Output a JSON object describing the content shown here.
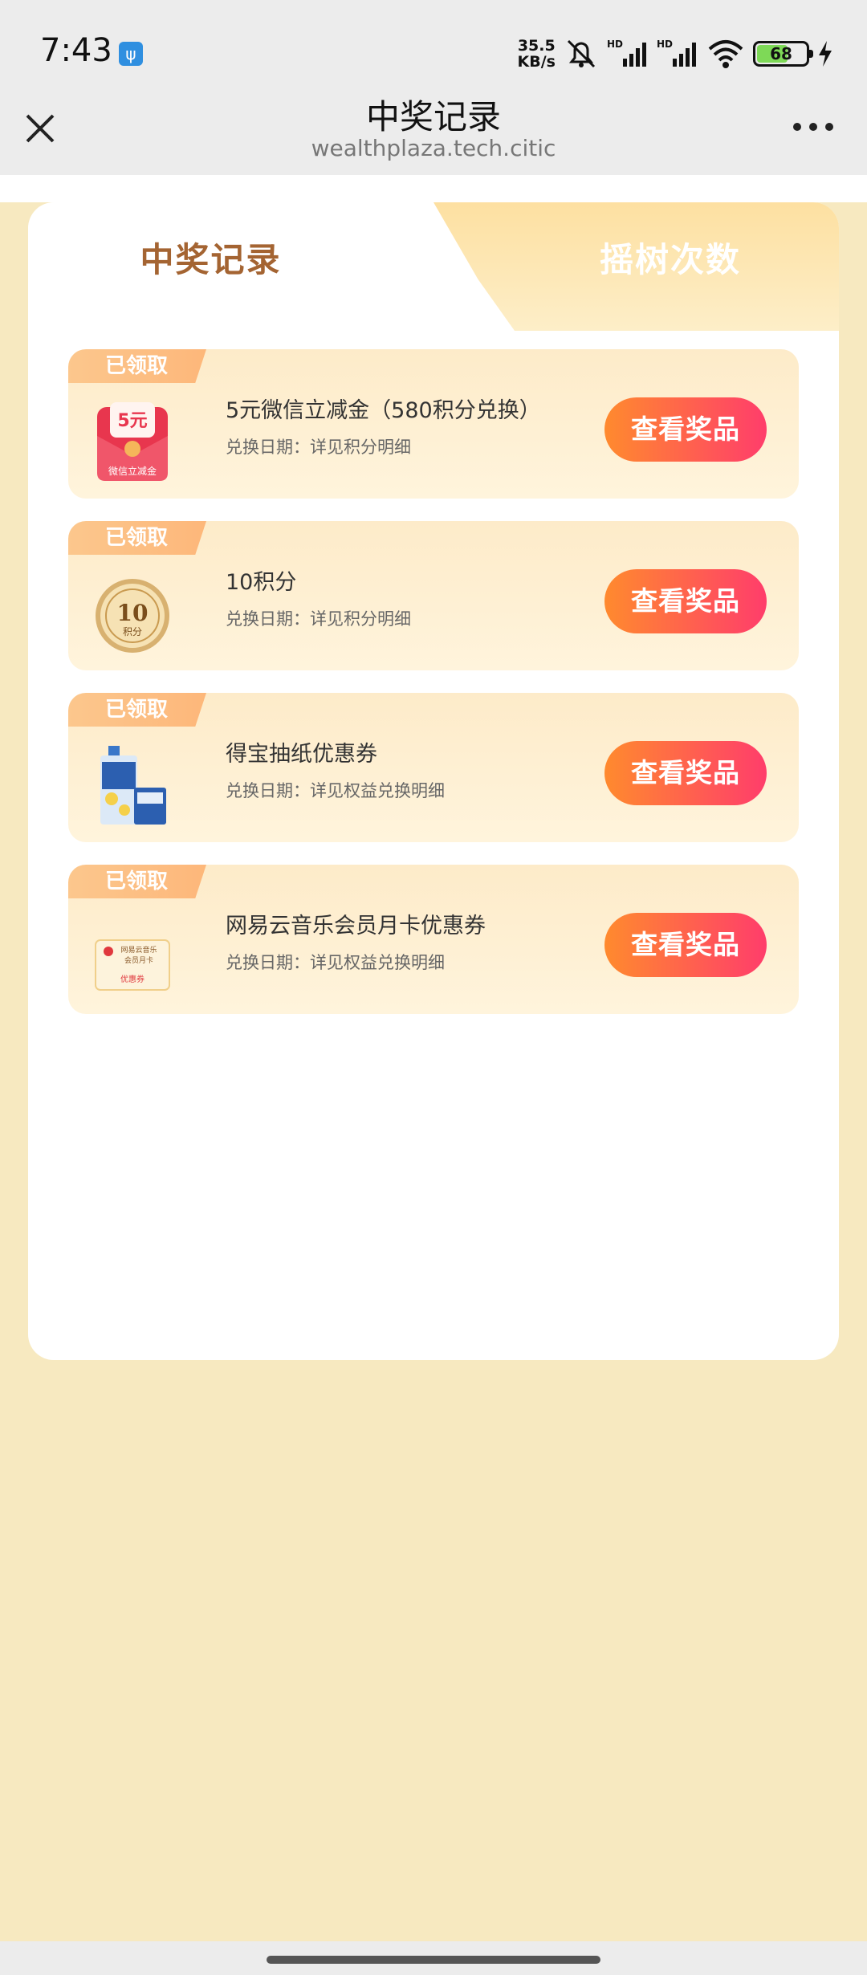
{
  "status": {
    "time": "7:43",
    "speed_top": "35.5",
    "speed_bottom": "KB/s",
    "battery": "68"
  },
  "nav": {
    "title": "中奖记录",
    "url": "wealthplaza.tech.citic"
  },
  "tabs": [
    {
      "label": "中奖记录",
      "active": true
    },
    {
      "label": "摇树次数",
      "active": false
    }
  ],
  "records": [
    {
      "badge": "已领取",
      "title": "5元微信立减金（580积分兑换）",
      "date": "兑换日期：详见积分明细",
      "button": "查看奖品",
      "thumb_text_top": "5元",
      "thumb_text_bottom": "微信立减金"
    },
    {
      "badge": "已领取",
      "title": "10积分",
      "date": "兑换日期：详见积分明细",
      "button": "查看奖品",
      "thumb_text_top": "10",
      "thumb_text_bottom": "积分"
    },
    {
      "badge": "已领取",
      "title": "得宝抽纸优惠券",
      "date": "兑换日期：详见权益兑换明细",
      "button": "查看奖品"
    },
    {
      "badge": "已领取",
      "title": "网易云音乐会员月卡优惠券",
      "date": "兑换日期：详见权益兑换明细",
      "button": "查看奖品",
      "thumb_text_top": "网易云音乐",
      "thumb_text_mid": "会员月卡",
      "thumb_text_bottom": "优惠券"
    }
  ],
  "colors": {
    "page_bg": "#f7e9c0",
    "button_start": "#ff8a2e",
    "button_end": "#ff3d6b",
    "tab_active_text": "#a46432"
  }
}
